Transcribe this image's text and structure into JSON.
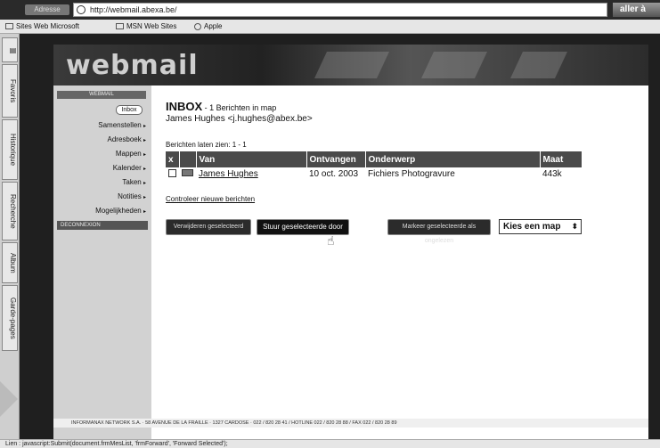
{
  "browser": {
    "address_label": "Adresse",
    "url": "http://webmail.abexa.be/",
    "go_label": "aller à",
    "favorites": [
      "Sites Web Microsoft",
      "MSN Web Sites",
      "Apple"
    ],
    "side_tabs": [
      "Favoris",
      "Historique",
      "Recherche",
      "Album",
      "Garde-pages"
    ],
    "status_text": "Lien : javascript:Submit(document.frmMesList, 'frmForward', 'Forward Selected');"
  },
  "site": {
    "logo": "webmail",
    "nav": {
      "header": "WEBMAIL",
      "inbox_badge": "Inbox",
      "items": [
        {
          "label": "Samenstellen"
        },
        {
          "label": "Adresboek"
        },
        {
          "label": "Mappen"
        },
        {
          "label": "Kalender"
        },
        {
          "label": "Taken"
        },
        {
          "label": "Notities"
        },
        {
          "label": "Mogelijkheden"
        }
      ],
      "logout": "DECONNEXION"
    },
    "main": {
      "title": "INBOX",
      "title_sub": " - 1 Berichten in map",
      "user": "James Hughes <j.hughes@abex.be>",
      "range": "Berichten laten zien: 1 - 1",
      "columns": [
        "x",
        "",
        "Van",
        "Ontvangen",
        "Onderwerp",
        "Maat"
      ],
      "rows": [
        {
          "from": "James Hughes",
          "received": "10 oct. 2003",
          "subject": "Fichiers Photogravure",
          "size": "443k"
        }
      ],
      "check_new": "Controleer nieuwe berichten",
      "buttons": {
        "delete": "Verwijderen geselecteerd",
        "forward": "Stuur geselecteerde door",
        "mark_unread": "Markeer geselecteerde als ongelezen"
      },
      "folder_select": "Kies een map"
    },
    "footer": "INFORMANAX NETWORK S.A. · 58 AVENUE DE LA FRAILLE · 1327 CARDOSE · 022 / 820 28 41 / HOTLINE 022 / 820 28 88 / FAX 022 / 820 28 89"
  }
}
